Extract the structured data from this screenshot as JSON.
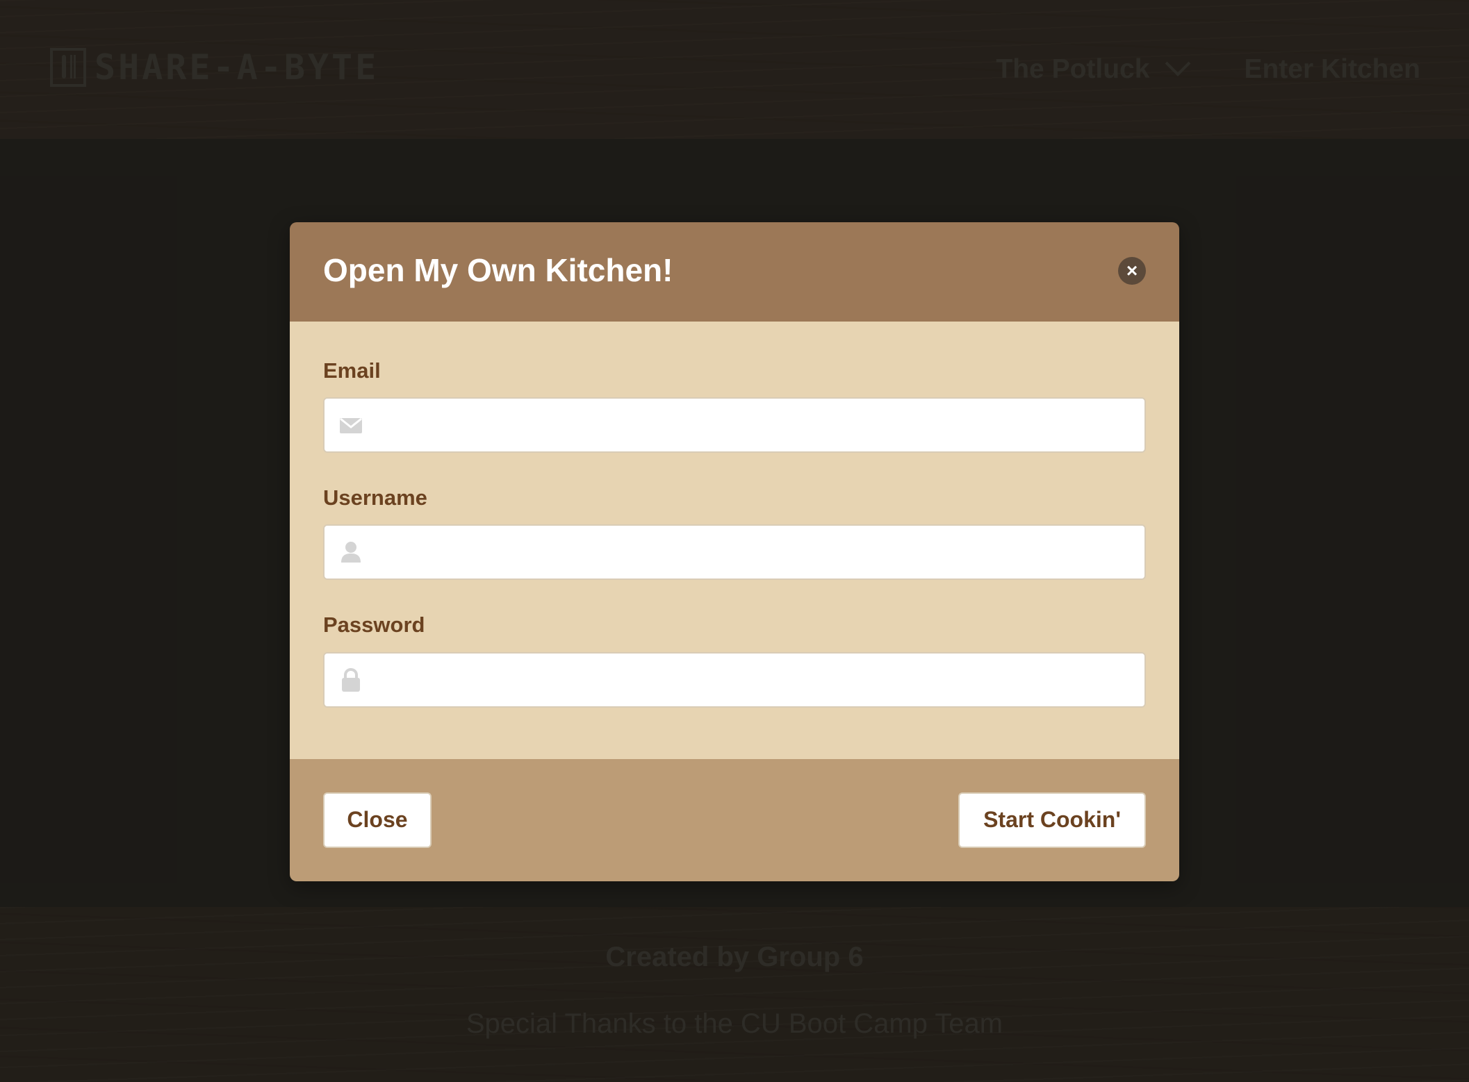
{
  "navbar": {
    "brand": "SHARE-A-BYTE",
    "links": [
      {
        "label": "The Potluck",
        "dropdown": true
      },
      {
        "label": "Enter Kitchen",
        "dropdown": false
      }
    ]
  },
  "footer": {
    "created": "Created by Group 6",
    "thanks": "Special Thanks to the CU Boot Camp Team"
  },
  "modal": {
    "title": "Open My Own Kitchen!",
    "close_icon": "×",
    "fields": {
      "email": {
        "label": "Email",
        "value": "",
        "placeholder": "",
        "icon": "envelope-icon"
      },
      "username": {
        "label": "Username",
        "value": "",
        "placeholder": "",
        "icon": "user-icon"
      },
      "password": {
        "label": "Password",
        "value": "",
        "placeholder": "",
        "icon": "lock-icon"
      }
    },
    "buttons": {
      "close": "Close",
      "submit": "Start Cookin'"
    }
  },
  "colors": {
    "header": "#9c7857",
    "body": "#e7d4b2",
    "footer": "#bc9c76",
    "label_text": "#6b4220"
  }
}
